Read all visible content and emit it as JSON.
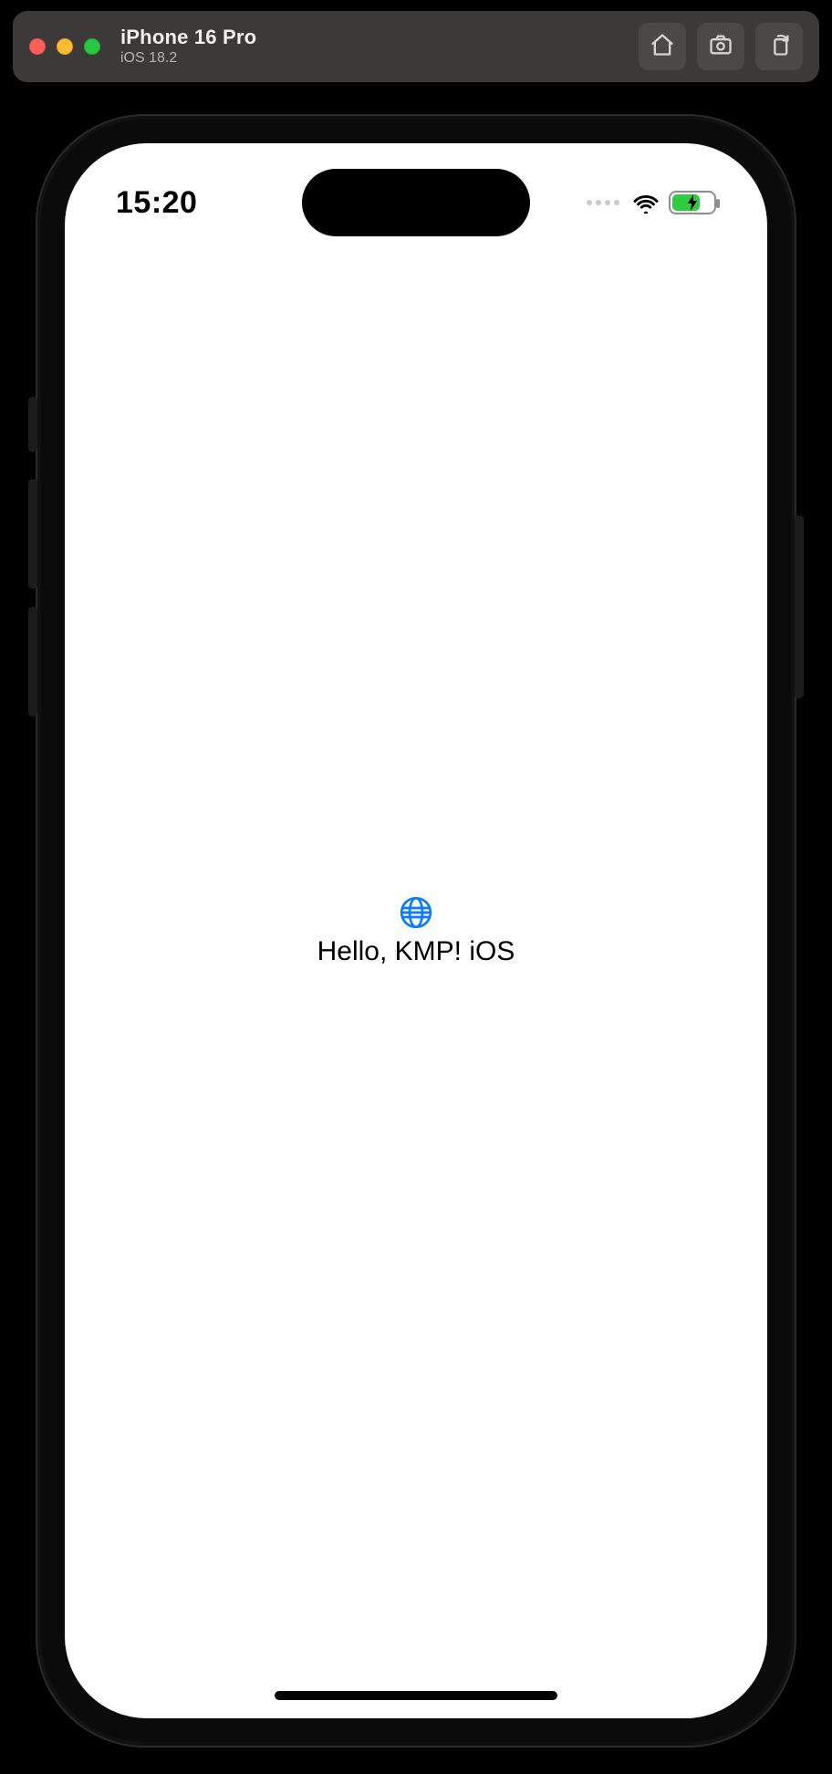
{
  "simulator": {
    "device": "iPhone 16 Pro",
    "os": "iOS 18.2",
    "buttons": {
      "home": "home",
      "screenshot": "screenshot",
      "rotate": "rotate"
    }
  },
  "status_bar": {
    "time": "15:20"
  },
  "app": {
    "greeting": "Hello, KMP! iOS"
  },
  "icons": {
    "globe": "globe-icon",
    "wifi": "wifi-icon",
    "battery": "battery-charging-icon",
    "home": "home-icon",
    "screenshot": "camera-icon",
    "rotate": "rotate-device-icon"
  },
  "colors": {
    "accent": "#0a7aff",
    "battery_fill": "#2ecc40"
  }
}
